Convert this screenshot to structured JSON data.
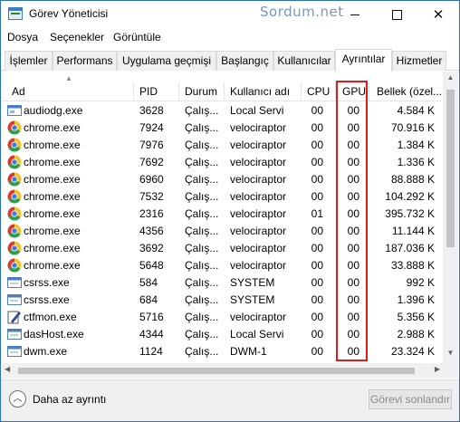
{
  "window": {
    "title": "Görev Yöneticisi",
    "watermark": "Sordum.net"
  },
  "menu": [
    "Dosya",
    "Seçenekler",
    "Görüntüle"
  ],
  "tabs": [
    "İşlemler",
    "Performans",
    "Uygulama geçmişi",
    "Başlangıç",
    "Kullanıcılar",
    "Ayrıntılar",
    "Hizmetler"
  ],
  "active_tab": "Ayrıntılar",
  "columns": [
    "Ad",
    "PID",
    "Durum",
    "Kullanıcı adı",
    "CPU",
    "GPU",
    "Bellek (özel..."
  ],
  "rows": [
    {
      "icon": "audiodg-icon",
      "name": "audiodg.exe",
      "pid": "3628",
      "status": "Çalış...",
      "user": "Local Servi",
      "cpu": "00",
      "gpu": "00",
      "mem": "4.584 K"
    },
    {
      "icon": "chrome-icon",
      "name": "chrome.exe",
      "pid": "7924",
      "status": "Çalış...",
      "user": "velociraptor",
      "cpu": "00",
      "gpu": "00",
      "mem": "70.916 K"
    },
    {
      "icon": "chrome-icon",
      "name": "chrome.exe",
      "pid": "7976",
      "status": "Çalış...",
      "user": "velociraptor",
      "cpu": "00",
      "gpu": "00",
      "mem": "1.384 K"
    },
    {
      "icon": "chrome-icon",
      "name": "chrome.exe",
      "pid": "7692",
      "status": "Çalış...",
      "user": "velociraptor",
      "cpu": "00",
      "gpu": "00",
      "mem": "1.336 K"
    },
    {
      "icon": "chrome-icon",
      "name": "chrome.exe",
      "pid": "6960",
      "status": "Çalış...",
      "user": "velociraptor",
      "cpu": "00",
      "gpu": "00",
      "mem": "88.888 K"
    },
    {
      "icon": "chrome-icon",
      "name": "chrome.exe",
      "pid": "7532",
      "status": "Çalış...",
      "user": "velociraptor",
      "cpu": "00",
      "gpu": "00",
      "mem": "104.292 K"
    },
    {
      "icon": "chrome-icon",
      "name": "chrome.exe",
      "pid": "2316",
      "status": "Çalış...",
      "user": "velociraptor",
      "cpu": "01",
      "gpu": "00",
      "mem": "395.732 K"
    },
    {
      "icon": "chrome-icon",
      "name": "chrome.exe",
      "pid": "4356",
      "status": "Çalış...",
      "user": "velociraptor",
      "cpu": "00",
      "gpu": "00",
      "mem": "11.144 K"
    },
    {
      "icon": "chrome-icon",
      "name": "chrome.exe",
      "pid": "3692",
      "status": "Çalış...",
      "user": "velociraptor",
      "cpu": "00",
      "gpu": "00",
      "mem": "187.036 K"
    },
    {
      "icon": "chrome-icon",
      "name": "chrome.exe",
      "pid": "5648",
      "status": "Çalış...",
      "user": "velociraptor",
      "cpu": "00",
      "gpu": "00",
      "mem": "33.888 K"
    },
    {
      "icon": "system-process-icon",
      "name": "csrss.exe",
      "pid": "584",
      "status": "Çalış...",
      "user": "SYSTEM",
      "cpu": "00",
      "gpu": "00",
      "mem": "992 K"
    },
    {
      "icon": "system-process-icon",
      "name": "csrss.exe",
      "pid": "684",
      "status": "Çalış...",
      "user": "SYSTEM",
      "cpu": "00",
      "gpu": "00",
      "mem": "1.396 K"
    },
    {
      "icon": "pen-icon",
      "name": "ctfmon.exe",
      "pid": "5716",
      "status": "Çalış...",
      "user": "velociraptor",
      "cpu": "00",
      "gpu": "00",
      "mem": "5.356 K"
    },
    {
      "icon": "system-process-icon",
      "name": "dasHost.exe",
      "pid": "4344",
      "status": "Çalış...",
      "user": "Local Servi",
      "cpu": "00",
      "gpu": "00",
      "mem": "2.988 K"
    },
    {
      "icon": "system-process-icon",
      "name": "dwm.exe",
      "pid": "1124",
      "status": "Çalış...",
      "user": "DWM-1",
      "cpu": "00",
      "gpu": "00",
      "mem": "23.324 K"
    }
  ],
  "footer": {
    "less_details": "Daha az ayrıntı",
    "end_task": "Görevi sonlandır"
  },
  "highlight_color": "#e01b1b"
}
